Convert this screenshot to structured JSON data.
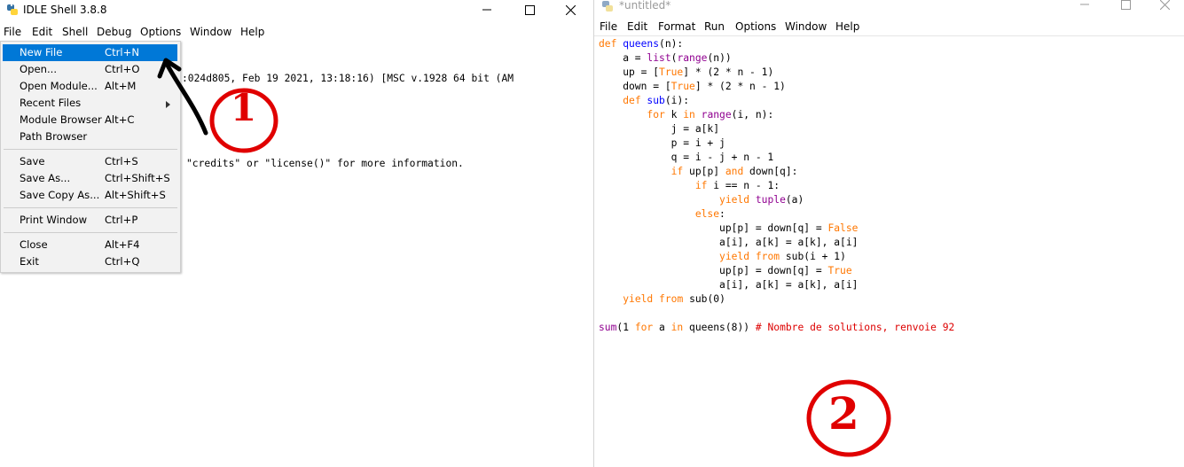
{
  "shell": {
    "title": "IDLE Shell 3.8.8",
    "menus": [
      "File",
      "Edit",
      "Shell",
      "Debug",
      "Options",
      "Window",
      "Help"
    ],
    "lines": [
      ":024d805, Feb 19 2021, 13:18:16) [MSC v.1928 64 bit (AM",
      "",
      "\"credits\" or \"license()\" for more information."
    ]
  },
  "file_menu": {
    "items": [
      {
        "label": "New File",
        "shortcut": "Ctrl+N",
        "highlighted": true
      },
      {
        "label": "Open...",
        "shortcut": "Ctrl+O"
      },
      {
        "label": "Open Module...",
        "shortcut": "Alt+M"
      },
      {
        "label": "Recent Files",
        "shortcut": ""
      },
      {
        "label": "Module Browser",
        "shortcut": "Alt+C"
      },
      {
        "label": "Path Browser",
        "shortcut": ""
      },
      {
        "label": "Save",
        "shortcut": "Ctrl+S"
      },
      {
        "label": "Save As...",
        "shortcut": "Ctrl+Shift+S"
      },
      {
        "label": "Save Copy As...",
        "shortcut": "Alt+Shift+S"
      },
      {
        "label": "Print Window",
        "shortcut": "Ctrl+P"
      },
      {
        "label": "Close",
        "shortcut": "Alt+F4"
      },
      {
        "label": "Exit",
        "shortcut": "Ctrl+Q"
      }
    ]
  },
  "editor": {
    "title": "*untitled*",
    "menus": [
      "File",
      "Edit",
      "Format",
      "Run",
      "Options",
      "Window",
      "Help"
    ],
    "code": [
      [
        [
          "kw",
          "def"
        ],
        [
          "",
          ""
        ],
        [
          "df",
          " queens"
        ],
        [
          "",
          "(n):"
        ]
      ],
      [
        [
          "",
          "    a = "
        ],
        [
          "bi",
          "list"
        ],
        [
          "",
          "("
        ],
        [
          "bi",
          "range"
        ],
        [
          "",
          "(n))"
        ]
      ],
      [
        [
          "",
          "    up = ["
        ],
        [
          "kw",
          "True"
        ],
        [
          "",
          "] * (2 * n - 1)"
        ]
      ],
      [
        [
          "",
          "    down = ["
        ],
        [
          "kw",
          "True"
        ],
        [
          "",
          "] * (2 * n - 1)"
        ]
      ],
      [
        [
          "",
          "    "
        ],
        [
          "kw",
          "def"
        ],
        [
          "df",
          " sub"
        ],
        [
          "",
          "(i):"
        ]
      ],
      [
        [
          "",
          "        "
        ],
        [
          "kw",
          "for"
        ],
        [
          "",
          " k "
        ],
        [
          "kw",
          "in"
        ],
        [
          "",
          " "
        ],
        [
          "bi",
          "range"
        ],
        [
          "",
          "(i, n):"
        ]
      ],
      [
        [
          "",
          "            j = a[k]"
        ]
      ],
      [
        [
          "",
          "            p = i + j"
        ]
      ],
      [
        [
          "",
          "            q = i - j + n - 1"
        ]
      ],
      [
        [
          "",
          "            "
        ],
        [
          "kw",
          "if"
        ],
        [
          "",
          " up[p] "
        ],
        [
          "kw",
          "and"
        ],
        [
          "",
          " down[q]:"
        ]
      ],
      [
        [
          "",
          "                "
        ],
        [
          "kw",
          "if"
        ],
        [
          "",
          " i == n - 1:"
        ]
      ],
      [
        [
          "",
          "                    "
        ],
        [
          "kw",
          "yield"
        ],
        [
          "",
          " "
        ],
        [
          "bi",
          "tuple"
        ],
        [
          "",
          "(a)"
        ]
      ],
      [
        [
          "",
          "                "
        ],
        [
          "kw",
          "else"
        ],
        [
          "",
          ":"
        ]
      ],
      [
        [
          "",
          "                    up[p] = down[q] = "
        ],
        [
          "kw",
          "False"
        ]
      ],
      [
        [
          "",
          "                    a[i], a[k] = a[k], a[i]"
        ]
      ],
      [
        [
          "",
          "                    "
        ],
        [
          "kw",
          "yield"
        ],
        [
          "",
          " "
        ],
        [
          "kw",
          "from"
        ],
        [
          "",
          " sub(i + 1)"
        ]
      ],
      [
        [
          "",
          "                    up[p] = down[q] = "
        ],
        [
          "kw",
          "True"
        ]
      ],
      [
        [
          "",
          "                    a[i], a[k] = a[k], a[i]"
        ]
      ],
      [
        [
          "",
          "    "
        ],
        [
          "kw",
          "yield"
        ],
        [
          "",
          " "
        ],
        [
          "kw",
          "from"
        ],
        [
          "",
          " sub(0)"
        ]
      ],
      [
        [
          "",
          ""
        ]
      ],
      [
        [
          "bi",
          "sum"
        ],
        [
          "",
          "(1 "
        ],
        [
          "kw",
          "for"
        ],
        [
          "",
          " a "
        ],
        [
          "kw",
          "in"
        ],
        [
          "",
          " queens(8)) "
        ],
        [
          "cm",
          "# Nombre de solutions, renvoie 92"
        ]
      ]
    ]
  },
  "annotations": [
    "1",
    "2"
  ],
  "colors": {
    "highlight": "#0078d7",
    "annotation": "#e00000",
    "keyword": "#ff7700",
    "builtin": "#900090",
    "defname": "#0000ff",
    "comment": "#dd0000"
  }
}
